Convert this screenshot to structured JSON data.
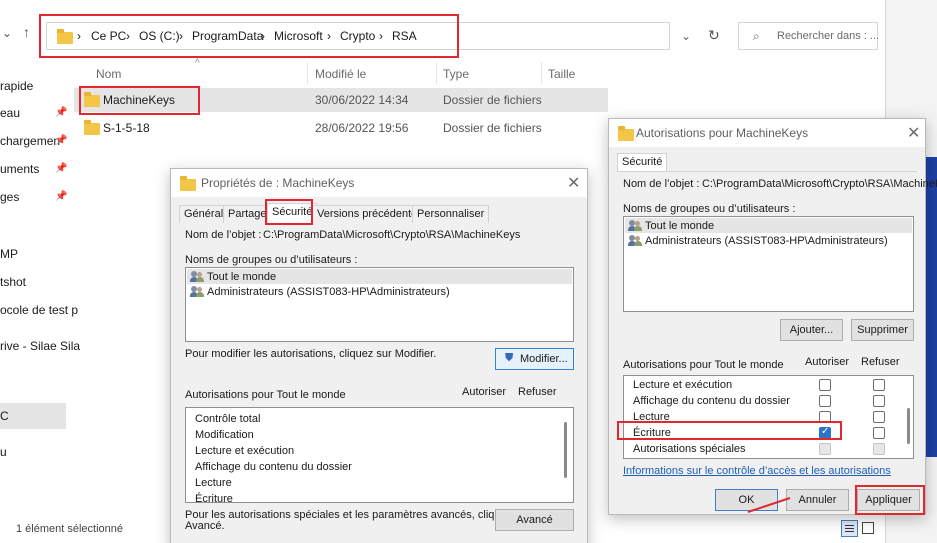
{
  "explorer": {
    "breadcrumb": [
      "Ce PC",
      "OS (C:)",
      "ProgramData",
      "Microsoft",
      "Crypto",
      "RSA"
    ],
    "search_placeholder": "Rechercher dans : ...",
    "columns": {
      "name": "Nom",
      "modified": "Modifié le",
      "type": "Type",
      "size": "Taille"
    },
    "sidebar": [
      "rapide",
      "eau",
      "chargemen",
      "uments",
      "ges",
      "MP",
      "tshot",
      "ocole de test p",
      "rive - Silae Sila",
      "C",
      "u"
    ],
    "files": [
      {
        "name": "MachineKeys",
        "modified": "30/06/2022 14:34",
        "type": "Dossier de fichiers"
      },
      {
        "name": "S-1-5-18",
        "modified": "28/06/2022 19:56",
        "type": "Dossier de fichiers"
      }
    ],
    "status": "1 élément sélectionné"
  },
  "props": {
    "title": "Propriétés de : MachineKeys",
    "tabs": [
      "Général",
      "Partage",
      "Sécurité",
      "Versions précédentes",
      "Personnaliser"
    ],
    "object_label": "Nom de l’objet :",
    "object_value": "C:\\ProgramData\\Microsoft\\Crypto\\RSA\\MachineKeys",
    "groups_label": "Noms de groupes ou d’utilisateurs :",
    "groups": [
      "Tout le monde",
      "Administrateurs (ASSIST083-HP\\Administrateurs)"
    ],
    "modify_hint": "Pour modifier les autorisations, cliquez sur Modifier.",
    "modify_btn": "Modifier...",
    "perm_label": "Autorisations pour Tout le monde",
    "allow": "Autoriser",
    "deny": "Refuser",
    "perms": [
      "Contrôle total",
      "Modification",
      "Lecture et exécution",
      "Affichage du contenu du dossier",
      "Lecture",
      "Écriture"
    ],
    "advanced_hint_1": "Pour les autorisations spéciales et les paramètres avancés, cliquez sur",
    "advanced_hint_2": "Avancé.",
    "advanced_btn": "Avancé"
  },
  "perm_dialog": {
    "title": "Autorisations pour MachineKeys",
    "tab": "Sécurité",
    "object_label": "Nom de l’objet :",
    "object_value": "C:\\ProgramData\\Microsoft\\Crypto\\RSA\\MachineK",
    "groups_label": "Noms de groupes ou d’utilisateurs :",
    "groups": [
      "Tout le monde",
      "Administrateurs (ASSIST083-HP\\Administrateurs)"
    ],
    "add_btn": "Ajouter...",
    "remove_btn": "Supprimer",
    "perm_label": "Autorisations pour Tout le monde",
    "allow": "Autoriser",
    "deny": "Refuser",
    "perms": [
      {
        "name": "Lecture et exécution",
        "allow": false,
        "deny": false
      },
      {
        "name": "Affichage du contenu du dossier",
        "allow": false,
        "deny": false
      },
      {
        "name": "Lecture",
        "allow": false,
        "deny": false
      },
      {
        "name": "Écriture",
        "allow": true,
        "deny": false
      },
      {
        "name": "Autorisations spéciales",
        "allow": false,
        "deny": false
      }
    ],
    "link": "Informations sur le contrôle d’accès et les autorisations",
    "ok": "OK",
    "cancel": "Annuler",
    "apply": "Appliquer"
  },
  "colors": {
    "highlight": "#e0282e",
    "accent": "#2b73c4",
    "selection": "#e5e5e5"
  }
}
